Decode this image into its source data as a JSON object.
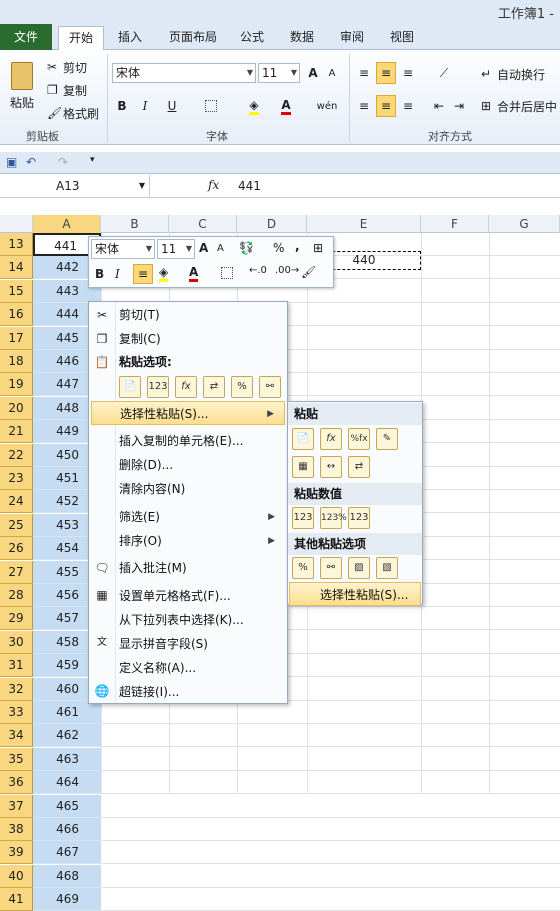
{
  "title": "工作簿1 -",
  "tabs": [
    "文件",
    "开始",
    "插入",
    "页面布局",
    "公式",
    "数据",
    "审阅",
    "视图"
  ],
  "clipboard": {
    "paste": "粘贴",
    "cut": "剪切",
    "copy": "复制",
    "painter": "格式刷",
    "label": "剪贴板"
  },
  "font": {
    "name": "宋体",
    "size": "11",
    "label": "字体",
    "grow": "A",
    "shrink": "A",
    "bold": "B",
    "italic": "I",
    "underline": "U",
    "wen": "wén"
  },
  "align": {
    "wrap": "自动换行",
    "merge": "合并后居中",
    "label": "对齐方式"
  },
  "namebox": "A13",
  "fx": "fx",
  "formula": "441",
  "columns": [
    "A",
    "B",
    "C",
    "D",
    "E",
    "F",
    "G"
  ],
  "rows": [
    {
      "n": "13",
      "a": "441"
    },
    {
      "n": "14",
      "a": "442"
    },
    {
      "n": "15",
      "a": "443"
    },
    {
      "n": "16",
      "a": "444"
    },
    {
      "n": "17",
      "a": "445"
    },
    {
      "n": "18",
      "a": "446"
    },
    {
      "n": "19",
      "a": "447"
    },
    {
      "n": "20",
      "a": "448"
    },
    {
      "n": "21",
      "a": "449"
    },
    {
      "n": "22",
      "a": "450"
    },
    {
      "n": "23",
      "a": "451"
    },
    {
      "n": "24",
      "a": "452"
    },
    {
      "n": "25",
      "a": "453"
    },
    {
      "n": "26",
      "a": "454"
    },
    {
      "n": "27",
      "a": "455"
    },
    {
      "n": "28",
      "a": "456"
    },
    {
      "n": "29",
      "a": "457"
    },
    {
      "n": "30",
      "a": "458"
    },
    {
      "n": "31",
      "a": "459"
    },
    {
      "n": "32",
      "a": "460"
    },
    {
      "n": "33",
      "a": "461"
    },
    {
      "n": "34",
      "a": "462"
    },
    {
      "n": "35",
      "a": "463"
    },
    {
      "n": "36",
      "a": "464"
    },
    {
      "n": "37",
      "a": "465"
    },
    {
      "n": "38",
      "a": "466"
    },
    {
      "n": "39",
      "a": "467"
    },
    {
      "n": "40",
      "a": "468"
    },
    {
      "n": "41",
      "a": "469"
    }
  ],
  "copied_cell": "440",
  "mini": {
    "font": "宋体",
    "size": "11",
    "bold": "B",
    "italic": "I",
    "percent": "%",
    "comma": ","
  },
  "context_menu": {
    "cut": "剪切(T)",
    "copy": "复制(C)",
    "paste_options": "粘贴选项:",
    "paste_special": "选择性粘贴(S)...",
    "insert_copied": "插入复制的单元格(E)...",
    "delete": "删除(D)...",
    "clear": "清除内容(N)",
    "filter": "筛选(E)",
    "sort": "排序(O)",
    "insert_comment": "插入批注(M)",
    "format_cells": "设置单元格格式(F)...",
    "pick_list": "从下拉列表中选择(K)...",
    "phonetic": "显示拼音字段(S)",
    "define_name": "定义名称(A)...",
    "hyperlink": "超链接(I)..."
  },
  "submenu": {
    "paste": "粘贴",
    "paste_values": "粘贴数值",
    "other": "其他粘贴选项",
    "paste_special": "选择性粘贴(S)..."
  }
}
